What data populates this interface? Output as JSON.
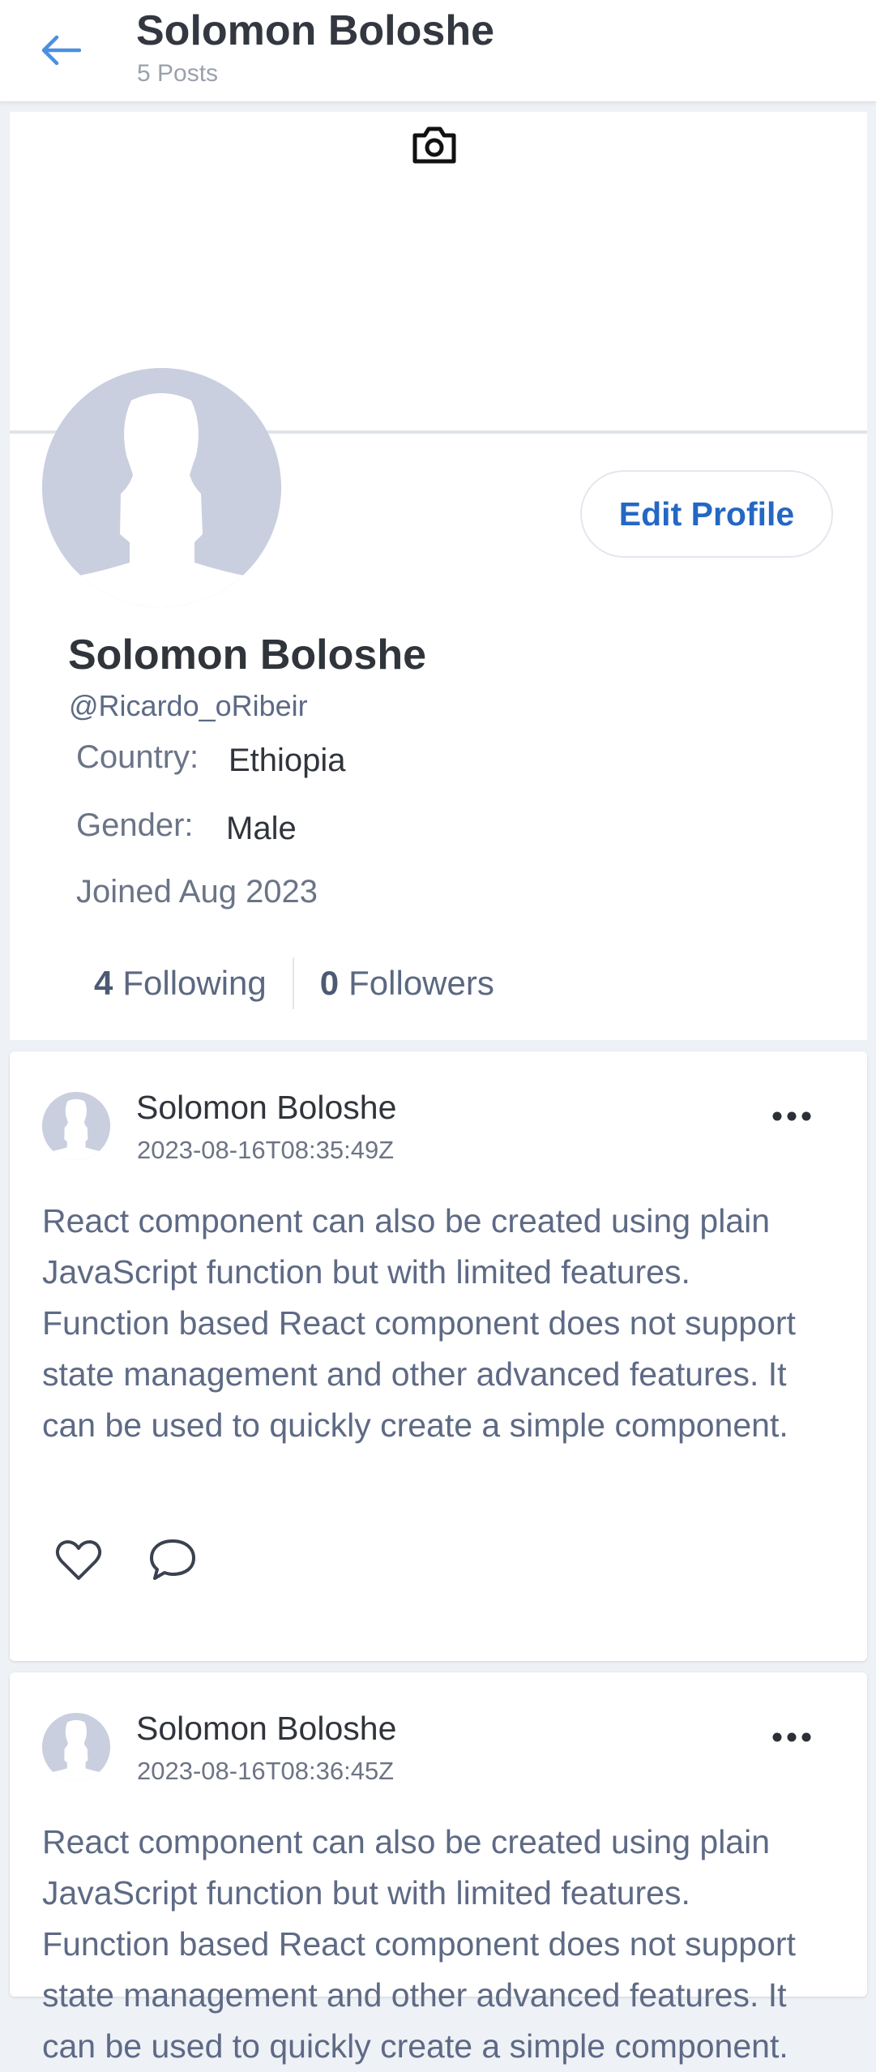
{
  "header": {
    "back_icon": "arrow-left-icon",
    "title": "Solomon Boloshe",
    "subtitle": "5 Posts"
  },
  "colors": {
    "accent": "#2467c4",
    "back_arrow": "#4a90e2",
    "avatar_placeholder": "#c9cfdf",
    "muted_text": "#5e6a85"
  },
  "profile": {
    "cover_icon": "camera-icon",
    "avatar_icon": "default-avatar-icon",
    "edit_button": "Edit Profile",
    "name": "Solomon Boloshe",
    "handle": "@Ricardo_oRibeir",
    "country_label": "Country:",
    "country_value": "Ethiopia",
    "gender_label": "Gender:",
    "gender_value": "Male",
    "joined": "Joined Aug 2023",
    "following_count": "4",
    "following_label": "Following",
    "followers_count": "0",
    "followers_label": "Followers"
  },
  "posts": [
    {
      "author": "Solomon Boloshe",
      "timestamp": "2023-08-16T08:35:49Z",
      "body": "React component can also be created using plain JavaScript function but with limited features. Function based React component does not support state management and other advanced features. It can be used to quickly create a simple component.",
      "more_icon": "more-horizontal-icon",
      "like_icon": "heart-icon",
      "comment_icon": "comment-icon"
    },
    {
      "author": "Solomon Boloshe",
      "timestamp": "2023-08-16T08:36:45Z",
      "body": "React component can also be created using plain JavaScript function but with limited features. Function based React component does not support state management and other advanced features. It can be used to quickly create a simple component.",
      "more_icon": "more-horizontal-icon"
    }
  ]
}
